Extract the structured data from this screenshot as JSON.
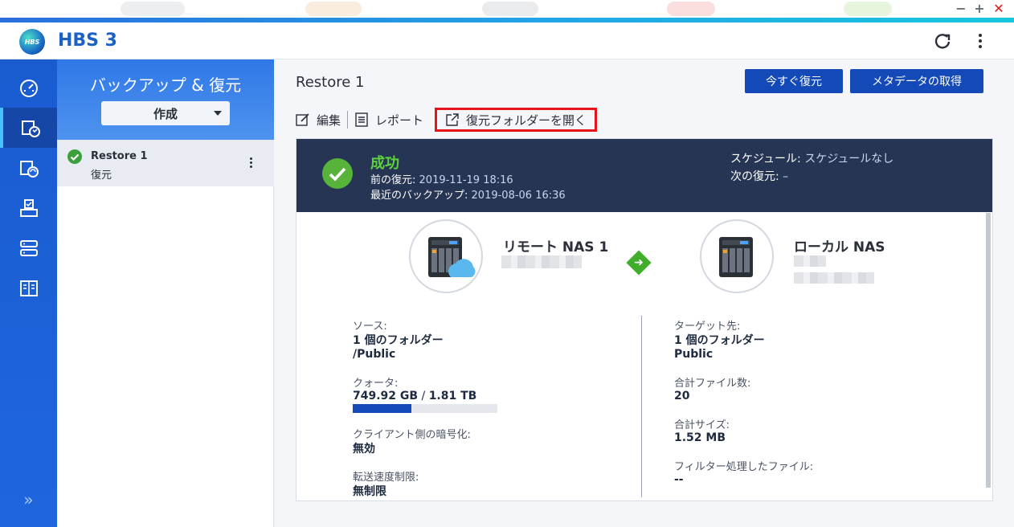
{
  "window": {
    "minimize": "−",
    "maximize": "+",
    "close": "✕"
  },
  "app": {
    "title": "HBS 3",
    "logo_text": "HBS"
  },
  "rail": {
    "items": [
      "dashboard-icon",
      "restore-icon",
      "sync-icon",
      "backup-versions-icon",
      "storage-spaces-icon",
      "services-icon"
    ],
    "expand_label": "»"
  },
  "panel2": {
    "title": "バックアップ & 復元",
    "create_label": "作成",
    "job": {
      "name": "Restore 1",
      "type": "復元"
    }
  },
  "main": {
    "job_title": "Restore 1",
    "restore_now_label": "今すぐ復元",
    "fetch_metadata_label": "メタデータの取得",
    "toolbar": {
      "edit_label": "編集",
      "report_label": "レポート",
      "open_folder_label": "復元フォルダーを開く"
    },
    "status": {
      "result": "成功",
      "previous_restore_label": "前の復元:",
      "previous_restore_value": "2019-11-19 18:16",
      "last_backup_label": "最近のバックアップ:",
      "last_backup_value": "2019-08-06 16:36",
      "schedule_label": "スケジュール:",
      "schedule_value": "スケジュールなし",
      "next_restore_label": "次の復元:",
      "next_restore_value": "–"
    },
    "source_nas": {
      "name": "リモート NAS 1"
    },
    "target_nas": {
      "name": "ローカル NAS"
    },
    "source": {
      "source_label": "ソース:",
      "folder_count": "1 個のフォルダー",
      "folder_path": "/Public",
      "quota_label": "クォータ:",
      "quota_used": "749.92 GB",
      "quota_sep": " / ",
      "quota_total": "1.81 TB",
      "quota_fraction": 0.405,
      "encryption_label": "クライアント側の暗号化:",
      "encryption_value": "無効",
      "speed_label": "転送速度制限:",
      "speed_value": "無制限"
    },
    "target": {
      "target_label": "ターゲット先:",
      "folder_count": "1 個のフォルダー",
      "folder_name": "Public",
      "file_count_label": "合計ファイル数:",
      "file_count_value": "20",
      "total_size_label": "合計サイズ:",
      "total_size_value": "1.52 MB",
      "filtered_label": "フィルター処理したファイル:",
      "filtered_value": "--"
    }
  },
  "colors": {
    "accent": "#1449b8",
    "rail": "#1f66dd",
    "status_band": "#253553",
    "success": "#5cd23e",
    "highlight_box": "#e8121a"
  }
}
